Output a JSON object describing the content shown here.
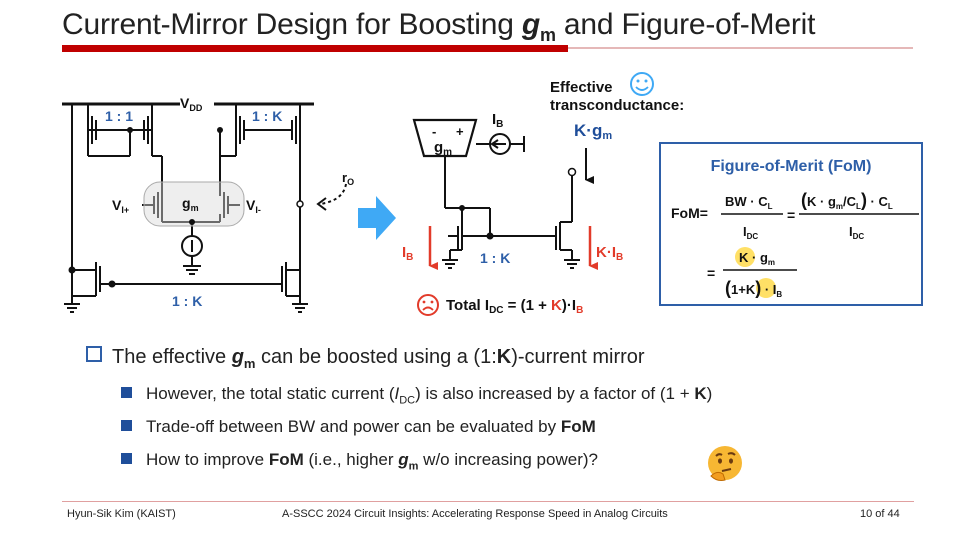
{
  "slide": {
    "title_pre": "Current-Mirror Design for Boosting ",
    "title_gm": "g",
    "title_gm_sub": "m",
    "title_post": " and Figure-of-Merit"
  },
  "left_circuit": {
    "ratio_top_left": "1 : 1",
    "ratio_top_right": "1 : K",
    "vdd_label": "V",
    "vdd_sub": "DD",
    "vin_plus": "V",
    "vin_plus_sub": "I+",
    "vin_minus": "V",
    "vin_minus_sub": "I-",
    "gm_label": "g",
    "gm_sub": "m",
    "ro_label": "r",
    "ro_sub": "O",
    "ratio_bottom": "1 : K"
  },
  "right_circuit": {
    "ib_top": "I",
    "ib_top_sub": "B",
    "gm_label": "g",
    "gm_sub": "m",
    "plus": "+",
    "minus": "-",
    "effective_label_1": "Effective",
    "effective_label_2": "transconductance:",
    "k_gm": "K·g",
    "k_gm_sub": "m",
    "ib_left": "I",
    "ib_left_sub": "B",
    "ratio": "1 : K",
    "k_ib": "K·I",
    "k_ib_sub": "B",
    "total_pre": "Total I",
    "total_sub": "DC",
    "total_mid": " = (1 + ",
    "total_k": "K",
    "total_post": ")·I",
    "total_post_sub": "B"
  },
  "fom": {
    "title": "Figure-of-Merit (FoM)",
    "fom_label": "FoM",
    "bw": "BW",
    "cl": "C",
    "cl_sub": "L",
    "idc": "I",
    "idc_sub": "DC",
    "k": "K",
    "gm": "g",
    "gm_sub": "m",
    "one": "1",
    "ib": "I",
    "ib_sub": "B"
  },
  "bullets": {
    "b1_pre": "The effective ",
    "b1_g": "g",
    "b1_m": "m",
    "b1_mid": " can be boosted using a (1:",
    "b1_k": "K",
    "b1_post": ")-current mirror",
    "b2_pre": "However, the total static current (",
    "b2_i": "I",
    "b2_dc": "DC",
    "b2_post": ") is also increased by a factor of (1 + ",
    "b2_k": "K",
    "b2_end": ")",
    "b3_pre": "Trade-off between BW and power can be evaluated by ",
    "b3_fom": "FoM",
    "b4_pre": "How to improve ",
    "b4_fom": "FoM",
    "b4_mid": " (i.e., higher ",
    "b4_g": "g",
    "b4_m": "m",
    "b4_post": " w/o increasing power)?"
  },
  "footer": {
    "author": "Hyun-Sik Kim (KAIST)",
    "event": "A-SSCC 2024 Circuit Insights: Accelerating Response Speed in Analog Circuits",
    "page": "10 of 44"
  },
  "colors": {
    "accent_red": "#c00000",
    "accent_blue": "#2e5fa8",
    "arrow_blue": "#3fa9f5",
    "highlight_yellow": "#ffe066"
  }
}
